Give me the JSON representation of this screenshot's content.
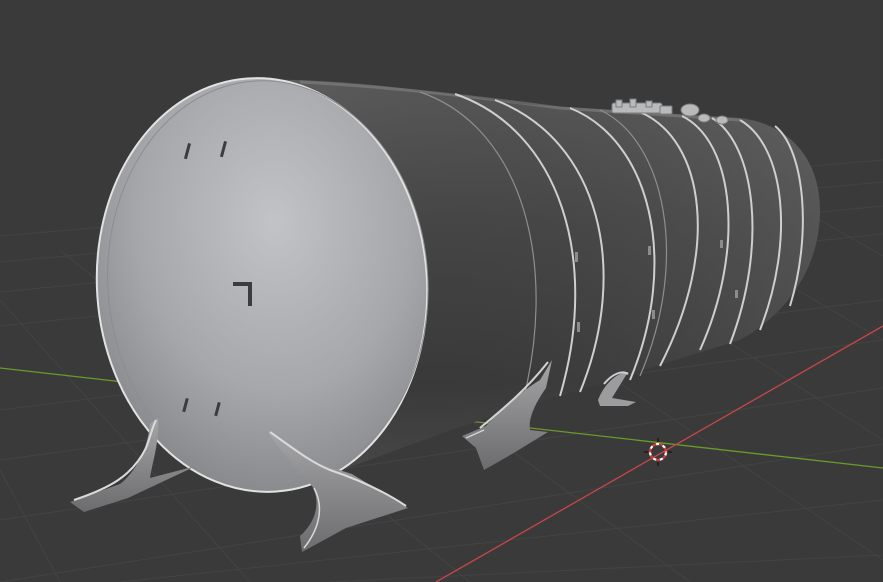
{
  "viewport": {
    "background_color": "#3a3a3a",
    "grid_color": "#444444",
    "x_axis_color": "#c8464a",
    "y_axis_color": "#6a9a2a"
  },
  "scene": {
    "object": "horizontal-pressure-tank-with-saddle-supports",
    "body_color": "#535353",
    "endcap_color": "#a8a9ac",
    "seam_color": "#d0d0d0",
    "cursor_icon": "3d-cursor-icon"
  }
}
